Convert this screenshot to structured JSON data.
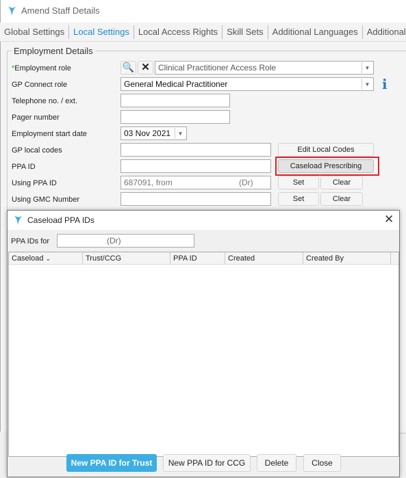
{
  "window": {
    "title": "Amend Staff Details"
  },
  "tabs": [
    {
      "label": "Global Settings"
    },
    {
      "label": "Local Settings",
      "active": true
    },
    {
      "label": "Local Access Rights"
    },
    {
      "label": "Skill Sets"
    },
    {
      "label": "Additional Languages"
    },
    {
      "label": "Additional Details"
    }
  ],
  "employment": {
    "legend": "Employment Details",
    "role_required_mark": "*",
    "role_label": "Employment role",
    "role_value": "Clinical Practitioner Access Role",
    "gp_connect_label": "GP Connect role",
    "gp_connect_value": "General Medical Practitioner",
    "telephone_label": "Telephone no. / ext.",
    "telephone_value": "",
    "pager_label": "Pager number",
    "pager_value": "",
    "start_date_label": "Employment start date",
    "start_date_value": "03 Nov 2021",
    "gp_local_codes_label": "GP local codes",
    "gp_local_codes_value": "",
    "edit_local_codes": "Edit Local Codes",
    "ppa_id_label": "PPA ID",
    "ppa_id_value": "",
    "caseload_prescribing": "Caseload Prescribing",
    "using_ppa_label": "Using PPA ID",
    "using_ppa_value": "687091, from",
    "using_ppa_suffix": "(Dr)",
    "using_gmc_label": "Using GMC Number",
    "using_gmc_value": "",
    "set": "Set",
    "clear": "Clear"
  },
  "highlight_color": "#e0202a",
  "dialog": {
    "title": "Caseload PPA IDs",
    "ppa_for_label": "PPA IDs for",
    "ppa_for_value": "(Dr)",
    "columns": [
      "Caseload",
      "Trust/CCG",
      "PPA ID",
      "Created",
      "Created By"
    ],
    "rows": [],
    "buttons": {
      "new_trust": "New PPA ID for Trust",
      "new_ccg": "New PPA ID for CCG",
      "delete": "Delete",
      "close": "Close"
    },
    "primary_color": "#3daee3"
  }
}
